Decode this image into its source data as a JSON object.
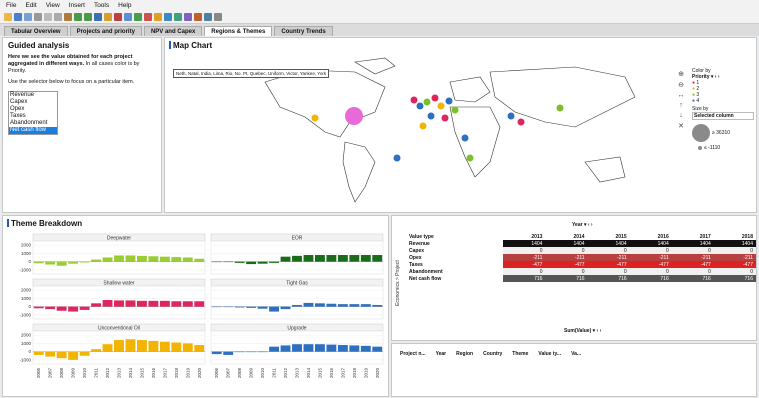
{
  "menu": [
    "File",
    "Edit",
    "View",
    "Insert",
    "Tools",
    "Help"
  ],
  "tabs": [
    {
      "label": "Tabular Overview",
      "active": false
    },
    {
      "label": "Projects and priority",
      "active": false
    },
    {
      "label": "NPV and Capex",
      "active": false
    },
    {
      "label": "Regions & Themes",
      "active": true
    },
    {
      "label": "Country Trends",
      "active": false
    }
  ],
  "guided": {
    "title": "Guided analysis",
    "intro_bold": "Here we see the value obtained for each project aggregated in different ways.",
    "intro_rest": " In all cases color is by Priority.",
    "selector_text": "Use the selector below to focus on a particular item.",
    "items": [
      "Revenue",
      "Capex",
      "Opex",
      "Taxes",
      "Abandonment",
      "Net cash flow"
    ],
    "selected_item": "Net cash flow"
  },
  "map": {
    "title": "Map Chart",
    "tooltip": "Neth, Natal, India, Lima, Rio, No. Pt, Quebec, Uniform, Victor, Yankee, York",
    "legend": {
      "color_by": "Color by",
      "field": "Priority",
      "items": [
        {
          "label": "1",
          "color": "#e0245e"
        },
        {
          "label": "2",
          "color": "#f2b400"
        },
        {
          "label": "3",
          "color": "#7cbf2a"
        },
        {
          "label": "4",
          "color": "#2d6fc0"
        }
      ],
      "size_by": "Size by",
      "size_field": "Selected column",
      "size_max": "≥ 36310",
      "size_min": "≤ -1110"
    }
  },
  "theme": {
    "title": "Theme Breakdown",
    "yticks_top": [
      "2000",
      "1000",
      "0",
      "-1000"
    ],
    "yticks_mid": [
      "2000",
      "1000",
      "0",
      "-1000"
    ],
    "yticks_bot": [
      "2000",
      "1000",
      "0",
      "-1000"
    ],
    "years": [
      "2006",
      "2007",
      "2008",
      "2009",
      "2010",
      "2011",
      "2012",
      "2013",
      "2014",
      "2015",
      "2016",
      "2017",
      "2018",
      "2019",
      "2020"
    ]
  },
  "chart_data": {
    "type": "bar",
    "x": [
      2006,
      2007,
      2008,
      2009,
      2010,
      2011,
      2012,
      2013,
      2014,
      2015,
      2016,
      2017,
      2018,
      2019,
      2020
    ],
    "ylim": [
      -1500,
      2500
    ],
    "facets": [
      {
        "name": "Deepwater",
        "color": "#9acd32",
        "values": [
          -200,
          -350,
          -500,
          -250,
          -100,
          250,
          500,
          750,
          750,
          700,
          650,
          600,
          550,
          500,
          350
        ]
      },
      {
        "name": "EOR",
        "color": "#1a6b1a",
        "values": [
          0,
          0,
          -150,
          -300,
          -250,
          -150,
          600,
          700,
          800,
          800,
          800,
          800,
          800,
          800,
          800
        ]
      },
      {
        "name": "Shallow water",
        "color": "#e0245e",
        "values": [
          -200,
          -300,
          -500,
          -600,
          -400,
          400,
          800,
          750,
          750,
          700,
          700,
          700,
          650,
          650,
          650
        ]
      },
      {
        "name": "Tight Gas",
        "color": "#2d6fc0",
        "values": [
          0,
          0,
          -100,
          -150,
          -250,
          -600,
          -300,
          200,
          450,
          400,
          350,
          300,
          300,
          300,
          200
        ]
      },
      {
        "name": "Unconventional Oil",
        "color": "#f2b400",
        "values": [
          -400,
          -600,
          -800,
          -1000,
          -500,
          300,
          900,
          1400,
          1500,
          1400,
          1300,
          1200,
          1100,
          1000,
          800
        ]
      },
      {
        "name": "Upgrade",
        "color": "#2d6fc0",
        "values": [
          -300,
          -400,
          0,
          0,
          0,
          600,
          750,
          900,
          900,
          900,
          850,
          800,
          750,
          700,
          600
        ]
      }
    ]
  },
  "pivot": {
    "column_selector": "Year",
    "header": [
      "Value type",
      "2013",
      "2014",
      "2015",
      "2016",
      "2017",
      "2018"
    ],
    "rows": [
      {
        "label": "Revenue",
        "values": [
          "1404",
          "1404",
          "1404",
          "1404",
          "1404",
          "1404"
        ],
        "bg": "#111111",
        "fg": "#ffffff"
      },
      {
        "label": "Capex",
        "values": [
          "0",
          "0",
          "0",
          "0",
          "0",
          "0"
        ],
        "bg": "#f0f0f0",
        "fg": "#222222"
      },
      {
        "label": "Opex",
        "values": [
          "-211",
          "-211",
          "-211",
          "-211",
          "-211",
          "-211"
        ],
        "bg": "#b84040",
        "fg": "#ffffff"
      },
      {
        "label": "Taxes",
        "values": [
          "-477",
          "-477",
          "-477",
          "-477",
          "-477",
          "-477"
        ],
        "bg": "#dd2222",
        "fg": "#ffffff"
      },
      {
        "label": "Abandonment",
        "values": [
          "0",
          "0",
          "0",
          "0",
          "0",
          "0"
        ],
        "bg": "#f0f0f0",
        "fg": "#222222"
      },
      {
        "label": "Net cash flow",
        "values": [
          "716",
          "716",
          "716",
          "716",
          "716",
          "716"
        ],
        "bg": "#555555",
        "fg": "#ffffff"
      }
    ],
    "side_label": "Economics > Project",
    "value_selector": "Sum(Value)"
  },
  "detail_header": [
    "Project n...",
    "Year",
    "Region",
    "Country",
    "Theme",
    "Value ty...",
    "Va..."
  ]
}
